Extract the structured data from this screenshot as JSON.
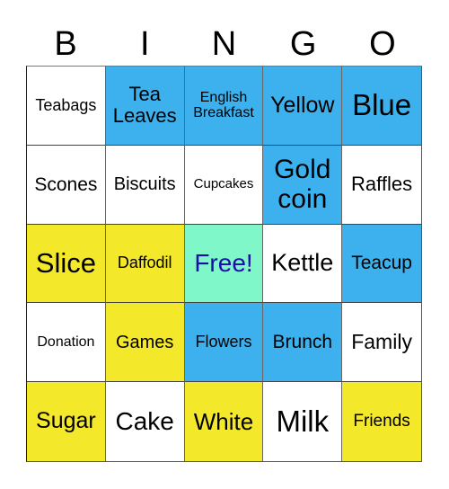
{
  "header": [
    "B",
    "I",
    "N",
    "G",
    "O"
  ],
  "colors": {
    "white": "#ffffff",
    "blue": "#3cb1ee",
    "yellow": "#f4e82a",
    "green": "#7ff7c8",
    "free_text": "#1a0fa6"
  },
  "cells": [
    {
      "text": "Teabags",
      "color": "white",
      "size": 18
    },
    {
      "text": "Tea Leaves",
      "color": "blue",
      "size": 22
    },
    {
      "text": "English Breakfast",
      "color": "blue",
      "size": 16
    },
    {
      "text": "Yellow",
      "color": "blue",
      "size": 25
    },
    {
      "text": "Blue",
      "color": "blue",
      "size": 33
    },
    {
      "text": "Scones",
      "color": "white",
      "size": 21
    },
    {
      "text": "Biscuits",
      "color": "white",
      "size": 20
    },
    {
      "text": "Cupcakes",
      "color": "white",
      "size": 15
    },
    {
      "text": "Gold coin",
      "color": "blue",
      "size": 30
    },
    {
      "text": "Raffles",
      "color": "white",
      "size": 22
    },
    {
      "text": "Slice",
      "color": "yellow",
      "size": 31
    },
    {
      "text": "Daffodil",
      "color": "yellow",
      "size": 18
    },
    {
      "text": "Free!",
      "color": "green",
      "size": 28,
      "free": true
    },
    {
      "text": "Kettle",
      "color": "white",
      "size": 27
    },
    {
      "text": "Teacup",
      "color": "blue",
      "size": 21
    },
    {
      "text": "Donation",
      "color": "white",
      "size": 16
    },
    {
      "text": "Games",
      "color": "yellow",
      "size": 20
    },
    {
      "text": "Flowers",
      "color": "blue",
      "size": 18
    },
    {
      "text": "Brunch",
      "color": "blue",
      "size": 21
    },
    {
      "text": "Family",
      "color": "white",
      "size": 23
    },
    {
      "text": "Sugar",
      "color": "yellow",
      "size": 25
    },
    {
      "text": "Cake",
      "color": "white",
      "size": 28
    },
    {
      "text": "White",
      "color": "yellow",
      "size": 26
    },
    {
      "text": "Milk",
      "color": "white",
      "size": 33
    },
    {
      "text": "Friends",
      "color": "yellow",
      "size": 19
    }
  ]
}
